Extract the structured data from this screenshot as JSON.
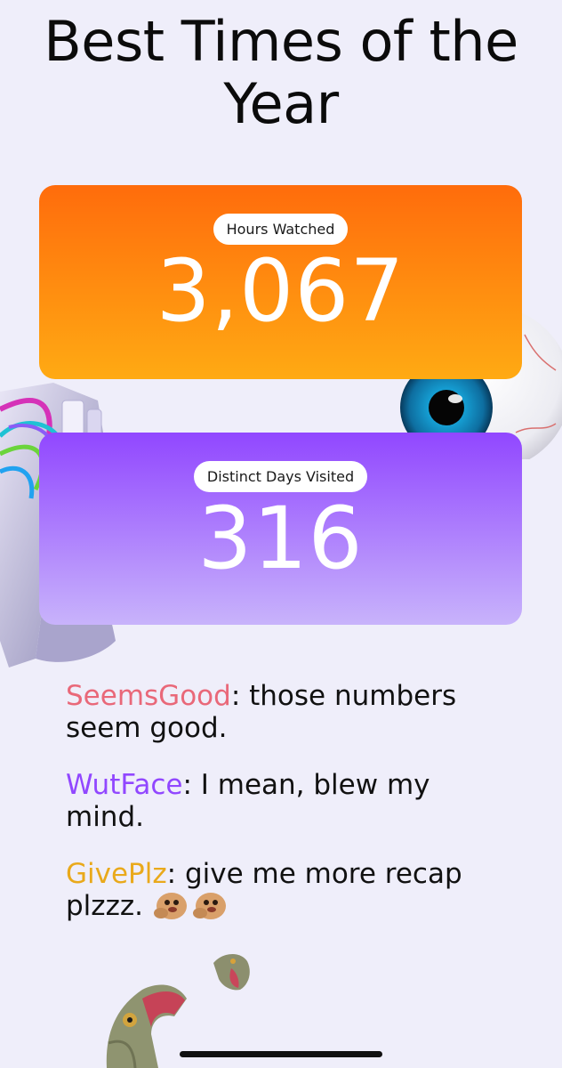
{
  "page": {
    "title": "Best Times of the Year",
    "background": "#efeefa"
  },
  "stats": [
    {
      "label": "Hours Watched",
      "value": "3,067",
      "color": "#ff7d0f"
    },
    {
      "label": "Distinct Days Visited",
      "value": "316",
      "color": "#9d5cff"
    }
  ],
  "chat": [
    {
      "user": "SeemsGood",
      "user_color": "#e96879",
      "sep": ":",
      "text": " those numbers seem good.",
      "emotes": []
    },
    {
      "user": "WutFace",
      "user_color": "#9147ff",
      "sep": ":",
      "text": " I mean, blew my mind.",
      "emotes": []
    },
    {
      "user": "GivePlz",
      "user_color": "#e9a91b",
      "sep": ":",
      "text": " give me more recap plzzz. ",
      "emotes": [
        "giveplz-emote-icon",
        "giveplz-emote-icon"
      ]
    }
  ],
  "decorations": [
    "game-controller-icon",
    "eyeball-icon",
    "lizard-icon"
  ]
}
